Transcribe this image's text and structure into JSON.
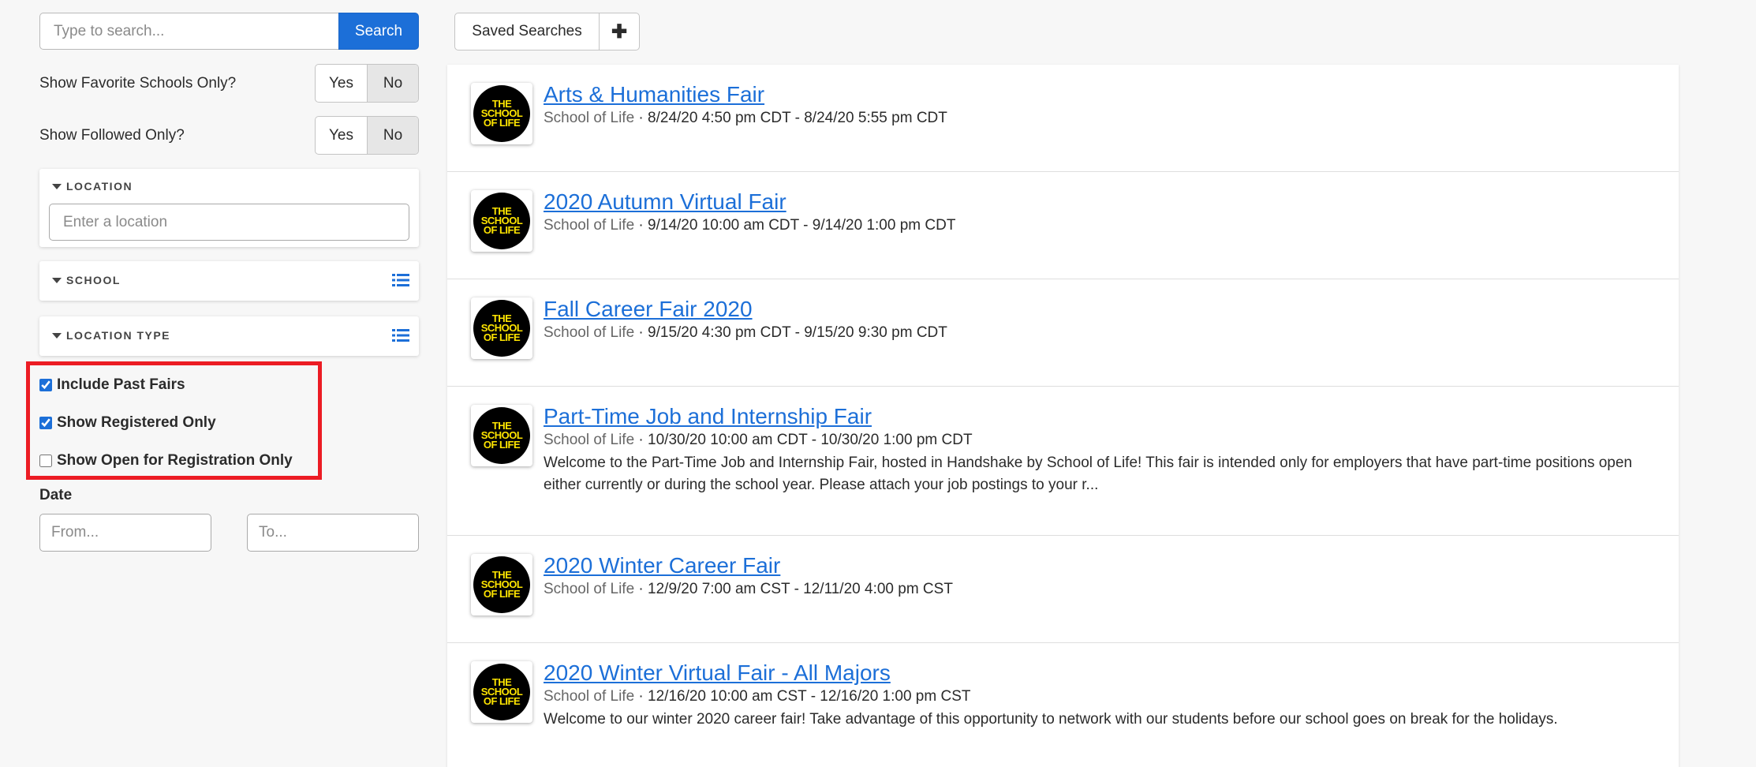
{
  "search": {
    "placeholder": "Type to search...",
    "button_label": "Search"
  },
  "favorite_toggle": {
    "label": "Show Favorite Schools Only?",
    "yes": "Yes",
    "no": "No",
    "selected": "No"
  },
  "followed_toggle": {
    "label": "Show Followed Only?",
    "yes": "Yes",
    "no": "No",
    "selected": "No"
  },
  "location_panel": {
    "title": "LOCATION",
    "placeholder": "Enter a location"
  },
  "school_panel": {
    "title": "SCHOOL"
  },
  "location_type_panel": {
    "title": "LOCATION TYPE"
  },
  "checkboxes": [
    {
      "label": "Include Past Fairs",
      "checked": true
    },
    {
      "label": "Show Registered Only",
      "checked": true
    },
    {
      "label": "Show Open for Registration Only",
      "checked": false
    }
  ],
  "date": {
    "label": "Date",
    "from_placeholder": "From...",
    "to_placeholder": "To..."
  },
  "saved_searches": {
    "label": "Saved Searches",
    "add_label": "✚"
  },
  "logo_text": [
    "THE",
    "SCHOOL",
    "OF LIFE"
  ],
  "colors": {
    "accent": "#1c6fd8",
    "logo_yellow": "#ffe500",
    "highlight": "#ec1c24"
  },
  "results": [
    {
      "title": "Arts & Humanities Fair",
      "school": "School of Life",
      "dates": " · 8/24/20 4:50 pm CDT - 8/24/20 5:55 pm CDT",
      "description": ""
    },
    {
      "title": "2020 Autumn Virtual Fair",
      "school": "School of Life",
      "dates": " · 9/14/20 10:00 am CDT - 9/14/20 1:00 pm CDT",
      "description": ""
    },
    {
      "title": "Fall Career Fair 2020",
      "school": "School of Life",
      "dates": " · 9/15/20 4:30 pm CDT - 9/15/20 9:30 pm CDT",
      "description": ""
    },
    {
      "title": "Part-Time Job and Internship Fair",
      "school": "School of Life",
      "dates": " · 10/30/20 10:00 am CDT - 10/30/20 1:00 pm CDT",
      "description": "Welcome to the Part-Time Job and Internship Fair, hosted in Handshake by School of Life! This fair is intended only for employers that have part-time positions open either currently or during the school year. Please attach your job postings to your r..."
    },
    {
      "title": "2020 Winter Career Fair",
      "school": "School of Life",
      "dates": " · 12/9/20 7:00 am CST - 12/11/20 4:00 pm CST",
      "description": ""
    },
    {
      "title": "2020 Winter Virtual Fair - All Majors",
      "school": "School of Life",
      "dates": " · 12/16/20 10:00 am CST - 12/16/20 1:00 pm CST",
      "description": "Welcome to our winter 2020 career fair! Take advantage of this opportunity to network with our students before our school goes on break for the holidays."
    }
  ]
}
